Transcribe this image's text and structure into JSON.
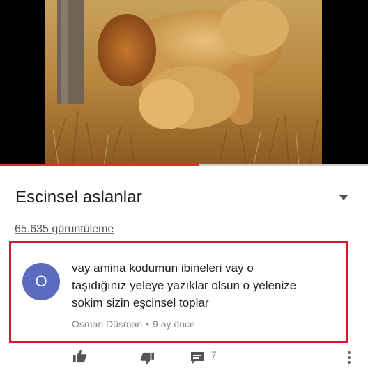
{
  "video": {
    "progress_fraction": 0.54
  },
  "title": "Escinsel aslanlar",
  "views": "65.635 görüntüleme",
  "comment": {
    "avatar_letter": "O",
    "avatar_color": "#5c6bc0",
    "lines": [
      "vay amina kodumun ibineleri vay o",
      "taşıdığınız yeleye yazıklar olsun o yelenize",
      "sokim sizin eşcinsel toplar"
    ],
    "author": "Osman Düsman",
    "separator": "•",
    "time": "9 ay önce",
    "reply_count": "7"
  },
  "highlight_color": "#d1192a",
  "icons": [
    "thumbs-up-icon",
    "thumbs-down-icon",
    "reply-icon",
    "more-vert-icon",
    "chevron-down-icon"
  ]
}
